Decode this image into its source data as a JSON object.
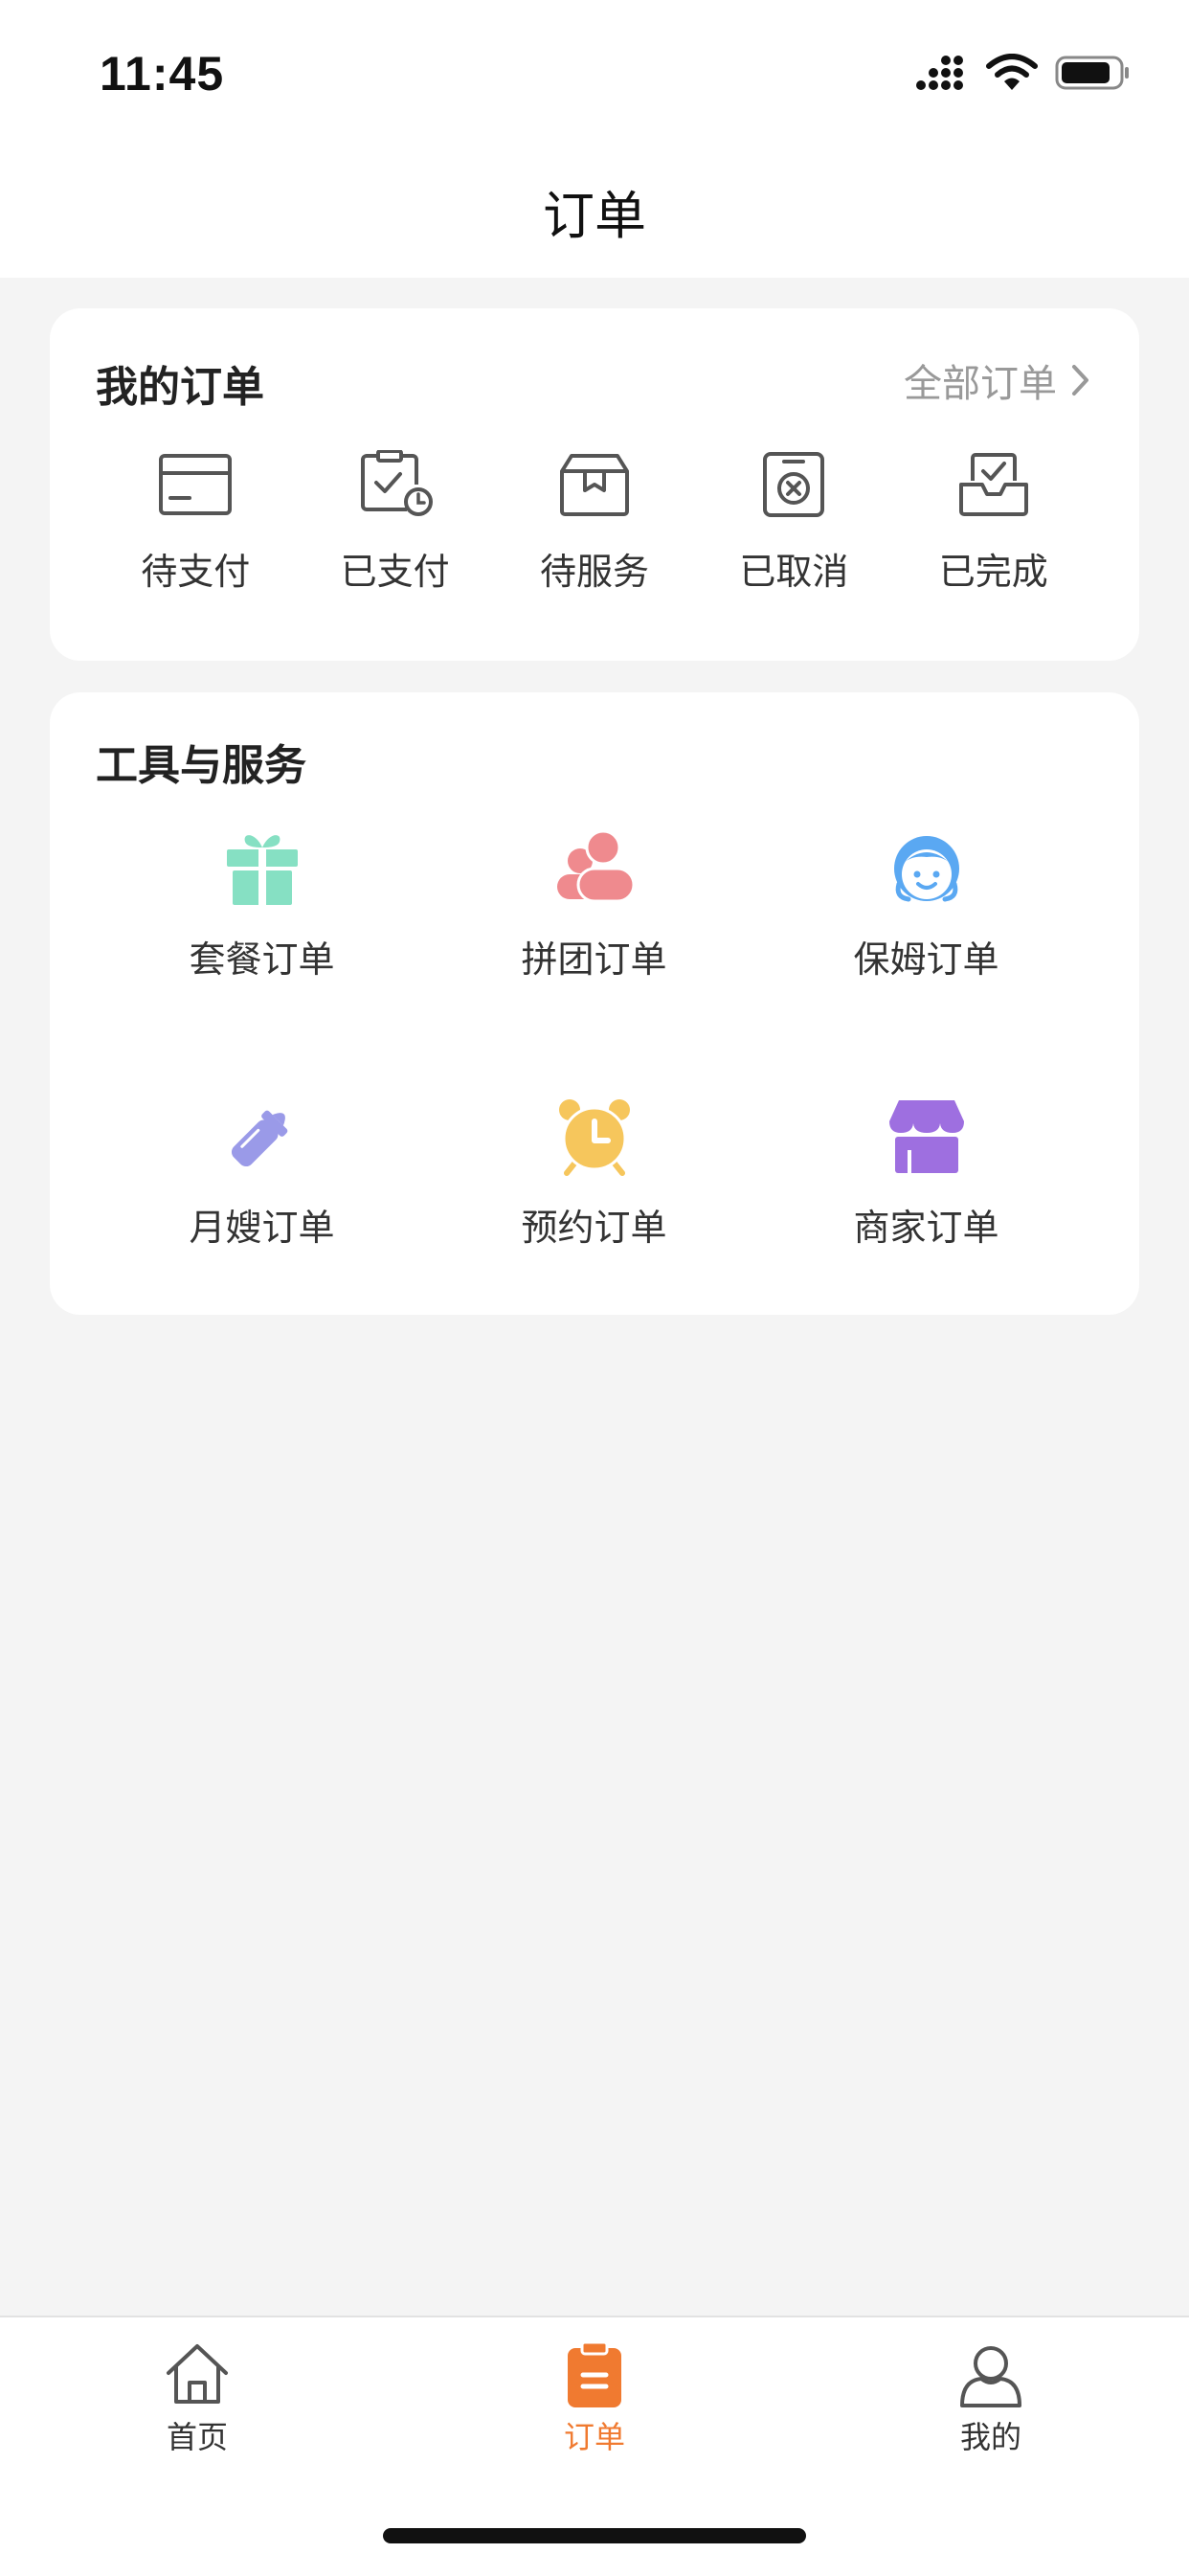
{
  "status_bar": {
    "time": "11:45"
  },
  "nav": {
    "title": "订单"
  },
  "my_orders": {
    "title": "我的订单",
    "all_label": "全部订单",
    "items": [
      {
        "label": "待支付",
        "icon": "card-icon"
      },
      {
        "label": "已支付",
        "icon": "clipboard-clock-icon"
      },
      {
        "label": "待服务",
        "icon": "box-icon"
      },
      {
        "label": "已取消",
        "icon": "cancel-icon"
      },
      {
        "label": "已完成",
        "icon": "inbox-check-icon"
      }
    ]
  },
  "tools": {
    "title": "工具与服务",
    "items": [
      {
        "label": "套餐订单",
        "icon": "gift-icon",
        "color": "#86e0c3"
      },
      {
        "label": "拼团订单",
        "icon": "group-icon",
        "color": "#ef8a8e"
      },
      {
        "label": "保姆订单",
        "icon": "nanny-icon",
        "color": "#5aa8f2"
      },
      {
        "label": "月嫂订单",
        "icon": "bottle-icon",
        "color": "#9a9ae8"
      },
      {
        "label": "预约订单",
        "icon": "alarm-clock-icon",
        "color": "#f6c65c"
      },
      {
        "label": "商家订单",
        "icon": "shop-icon",
        "color": "#9e6fe0"
      }
    ]
  },
  "tabbar": {
    "accent": "#f07a30",
    "items": [
      {
        "label": "首页",
        "icon": "home-icon"
      },
      {
        "label": "订单",
        "icon": "orders-icon"
      },
      {
        "label": "我的",
        "icon": "user-icon"
      }
    ]
  }
}
